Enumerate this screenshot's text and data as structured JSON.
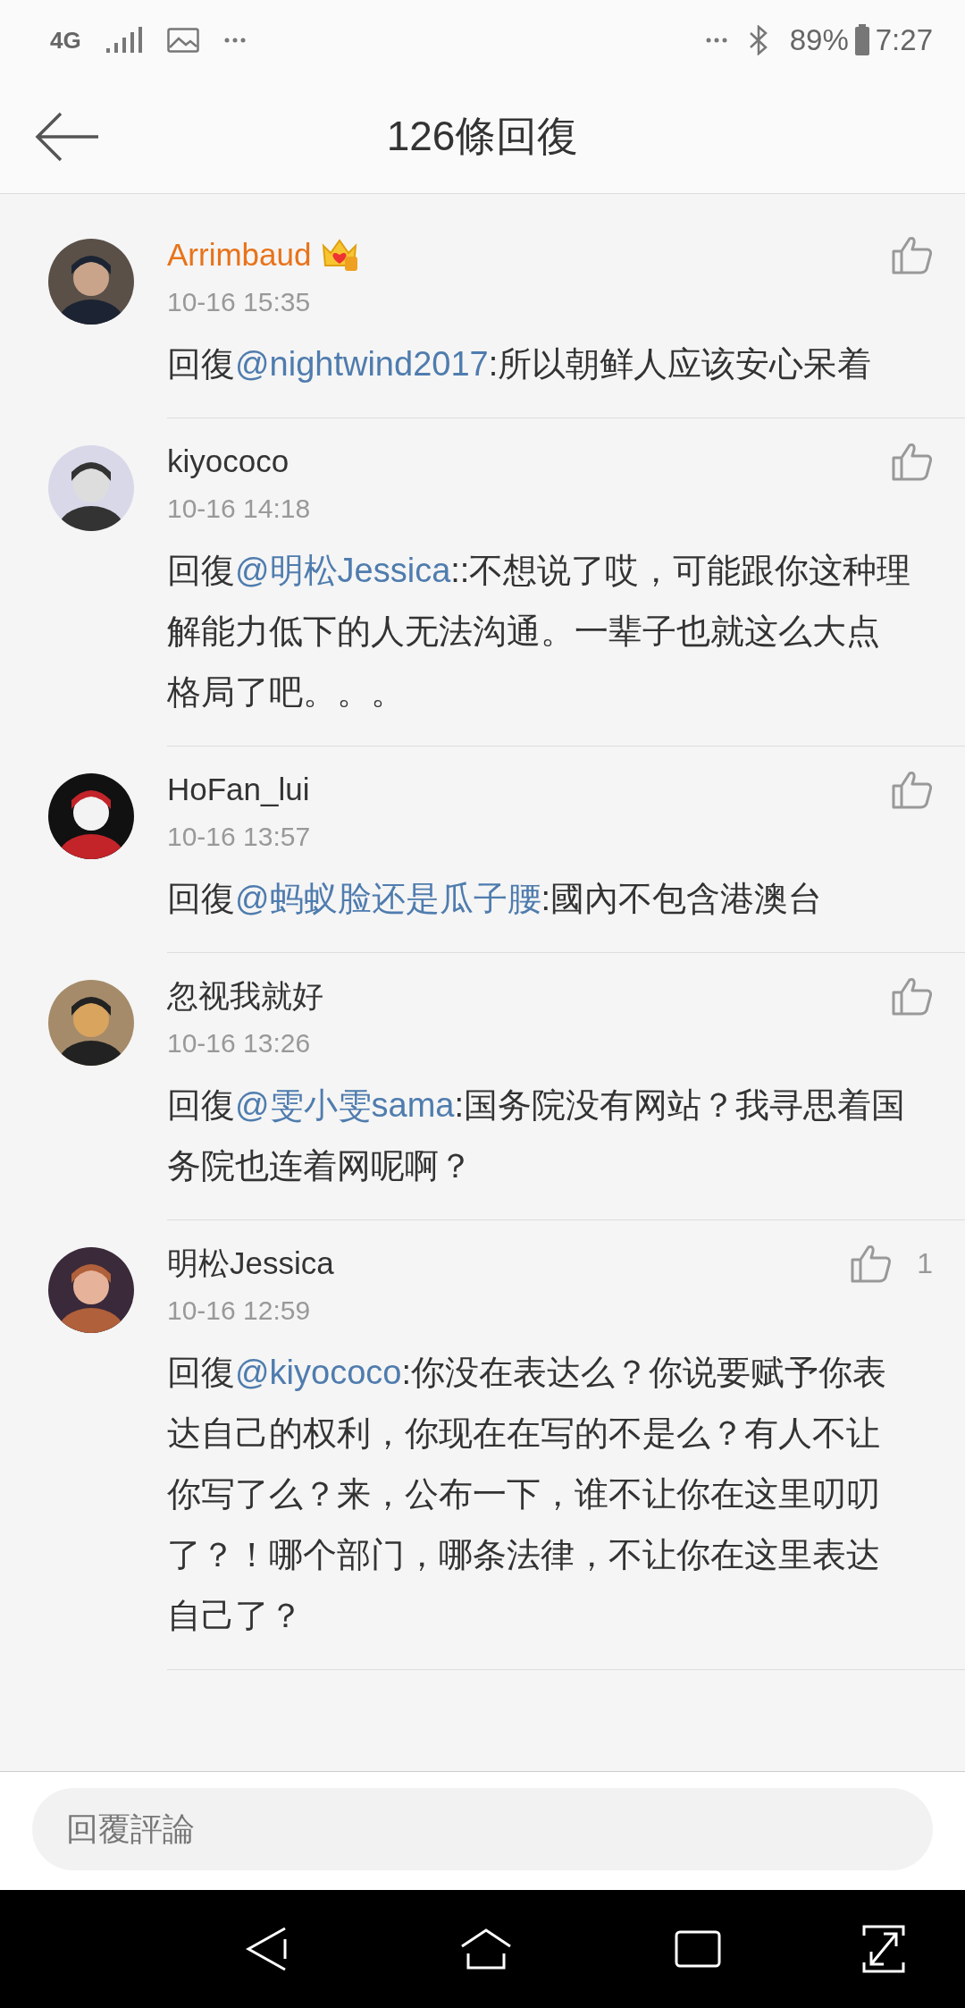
{
  "status_bar": {
    "network": "4G",
    "battery": "89%",
    "time": "7:27"
  },
  "header": {
    "title": "126條回復"
  },
  "comments": [
    {
      "user": "Arrimbaud",
      "vip": true,
      "time": "10-16 15:35",
      "prefix": "回復",
      "mention": "@nightwind2017",
      "text": ":所以朝鲜人应该安心呆着"
    },
    {
      "user": "kiyococo",
      "vip": false,
      "time": "10-16 14:18",
      "prefix": "回復",
      "mention": "@明松Jessica",
      "text": "::不想说了哎，可能跟你这种理解能力低下的人无法沟通。一辈子也就这么大点格局了吧。。。"
    },
    {
      "user": "HoFan_lui",
      "vip": false,
      "time": "10-16 13:57",
      "prefix": "回復",
      "mention": "@蚂蚁脸还是瓜子腰",
      "text": ":國內不包含港澳台"
    },
    {
      "user": "忽视我就好",
      "vip": false,
      "time": "10-16 13:26",
      "prefix": "回復",
      "mention": "@雯小雯sama",
      "text": ":国务院没有网站？我寻思着国务院也连着网呢啊？"
    },
    {
      "user": "明松Jessica",
      "vip": false,
      "time": "10-16 12:59",
      "prefix": "回復",
      "mention": "@kiyococo",
      "text": ":你没在表达么？你说要赋予你表达自己的权利，你现在在写的不是么？有人不让你写了么？来，公布一下，谁不让你在这里叨叨了？！哪个部门，哪条法律，不让你在这里表达自己了？",
      "likes": "1"
    }
  ],
  "reply_bar": {
    "placeholder": "回覆評論"
  }
}
